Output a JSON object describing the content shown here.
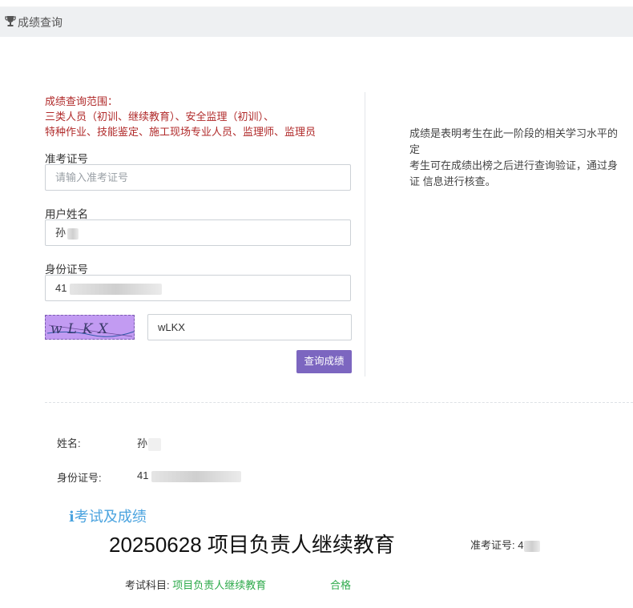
{
  "header": {
    "title": "成绩查询",
    "icon": "trophy-icon"
  },
  "scope": {
    "line1": "成绩查询范围：",
    "line2": "三类人员（初训、继续教育）、安全监理（初训）、",
    "line3": "特种作业、技能鉴定、施工现场专业人员、监理师、监理员"
  },
  "form": {
    "ticket_label": "准考证号",
    "ticket_placeholder": "请输入准考证号",
    "name_label": "用户姓名",
    "name_value": "孙",
    "id_label": "身份证号",
    "id_value": "41",
    "captcha_text": "wLKX",
    "captcha_input": "wLKX",
    "query_button": "查询成绩"
  },
  "info": {
    "line1": "成绩是表明考生在此一阶段的相关学习水平的",
    "line2": "定",
    "line3": "考生可在成绩出榜之后进行查询验证，通过身",
    "line4": "证 信息进行核查。"
  },
  "result": {
    "name_label": "姓名:",
    "name_value": "孙",
    "id_label": "身份证号:",
    "id_value": "41",
    "section_title": "考试及成绩",
    "exam_title": "20250628 项目负责人继续教育",
    "ticket_label": "准考证号:",
    "ticket_value": "4",
    "subject_label": "考试科目:",
    "subject_value": "项目负责人继续教育",
    "status": "合格"
  },
  "colors": {
    "accent": "#7c66c0",
    "pass": "#2eaa4b",
    "scope": "#b02a2a",
    "section": "#4aa3df"
  }
}
